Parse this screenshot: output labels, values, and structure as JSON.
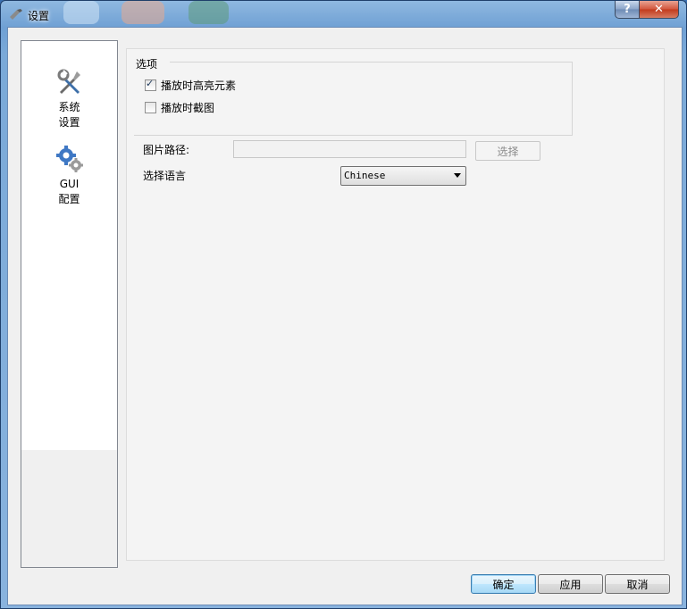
{
  "window": {
    "title": "设置",
    "help_label": "?",
    "close_label": "✕"
  },
  "sidebar": {
    "items": [
      {
        "label": "系统\n设置",
        "icon": "tools-icon"
      },
      {
        "label": "GUI\n配置",
        "icon": "gears-icon"
      }
    ]
  },
  "options": {
    "group_title": "选项",
    "highlight_label": "播放时高亮元素",
    "highlight_checked": true,
    "screenshot_label": "播放时截图",
    "screenshot_checked": false,
    "path_label": "图片路径:",
    "path_value": "",
    "choose_label": "选择"
  },
  "language": {
    "label": "选择语言",
    "selected": "Chinese"
  },
  "footer": {
    "ok_label": "确定",
    "apply_label": "应用",
    "cancel_label": "取消"
  },
  "colors": {
    "titlebar": "#7aa9d8",
    "close_button": "#c23a1c",
    "primary_button": "#a7d9f5"
  }
}
